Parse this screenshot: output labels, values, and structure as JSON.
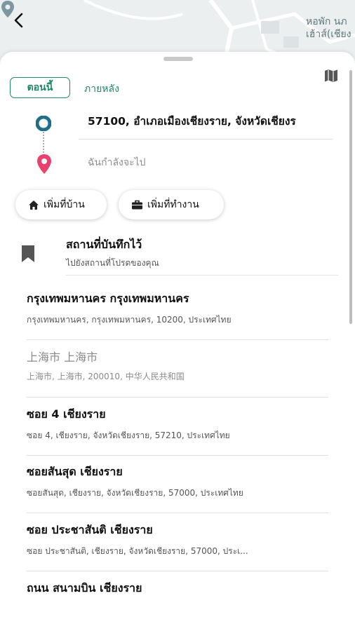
{
  "map": {
    "label_line1": "หอพัก นภ",
    "label_line2": "เฮ้าส์(เชียง"
  },
  "colors": {
    "accent": "#1e8a63",
    "origin": "#1f6f8b",
    "destination": "#e8416b"
  },
  "time_options": {
    "now": "ตอนนี้",
    "later": "ภายหลัง"
  },
  "origin": {
    "text": "57100, อำเภอเมืองเชียงราย, จังหวัดเชียงร"
  },
  "destination": {
    "placeholder": "ฉันกำลังจะไป"
  },
  "shortcuts": {
    "home": "เพิ่มที่บ้าน",
    "work": "เพิ่มที่ทำงาน"
  },
  "saved": {
    "title": "สถานที่บันทึกไว้",
    "subtitle": "ไปยังสถานที่โปรดของคุณ"
  },
  "results": [
    {
      "title": "กรุงเทพมหานคร กรุงเทพมหานคร",
      "subtitle": "กรุงเทพมหานคร, กรุงเทพมหานคร, 10200, ประเทศไทย"
    },
    {
      "title": "上海市 上海市",
      "subtitle": "上海市, 上海市, 200010, 中华人民共和国"
    },
    {
      "title": "ซอย 4 เชียงราย",
      "subtitle": "ซอย 4, เชียงราย, จังหวัดเชียงราย, 57210, ประเทศไทย"
    },
    {
      "title": "ซอยสันสุด เชียงราย",
      "subtitle": "ซอยสันสุด, เชียงราย, จังหวัดเชียงราย, 57000, ประเทศไทย"
    },
    {
      "title": "ซอย ประชาสันติ เชียงราย",
      "subtitle": "ซอย ประชาสันติ, เชียงราย, จังหวัดเชียงราย, 57000, ประเ..."
    },
    {
      "title": "ถนน สนามบิน เชียงราย",
      "subtitle": ""
    }
  ]
}
